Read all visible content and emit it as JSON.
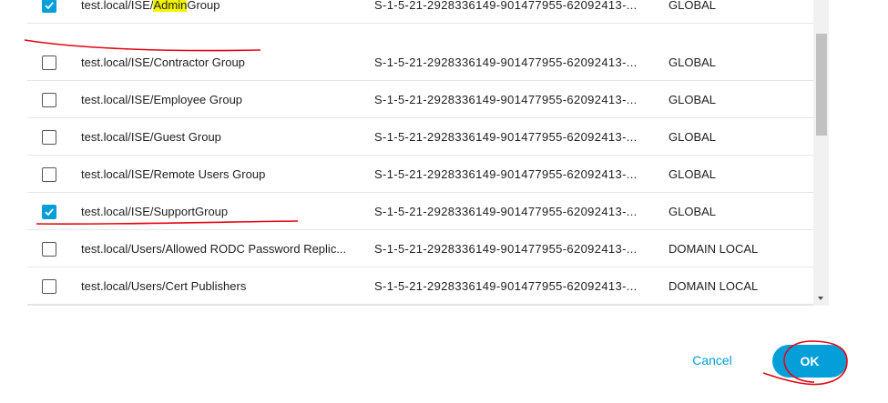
{
  "groups": [
    {
      "name_pre": "test.local/ISE/",
      "name_hl": "Admin",
      "name_post": "Group",
      "sid": "S-1-5-21-2928336149-901477955-62092413-...",
      "scope": "GLOBAL",
      "checked": true
    },
    {
      "name_pre": "test.local/ISE/Contractor Group",
      "name_hl": "",
      "name_post": "",
      "sid": "S-1-5-21-2928336149-901477955-62092413-...",
      "scope": "GLOBAL",
      "checked": false
    },
    {
      "name_pre": "test.local/ISE/Employee Group",
      "name_hl": "",
      "name_post": "",
      "sid": "S-1-5-21-2928336149-901477955-62092413-...",
      "scope": "GLOBAL",
      "checked": false
    },
    {
      "name_pre": "test.local/ISE/Guest Group",
      "name_hl": "",
      "name_post": "",
      "sid": "S-1-5-21-2928336149-901477955-62092413-...",
      "scope": "GLOBAL",
      "checked": false
    },
    {
      "name_pre": "test.local/ISE/Remote Users Group",
      "name_hl": "",
      "name_post": "",
      "sid": "S-1-5-21-2928336149-901477955-62092413-...",
      "scope": "GLOBAL",
      "checked": false
    },
    {
      "name_pre": "test.local/ISE/SupportGroup",
      "name_hl": "",
      "name_post": "",
      "sid": "S-1-5-21-2928336149-901477955-62092413-...",
      "scope": "GLOBAL",
      "checked": true
    },
    {
      "name_pre": "test.local/Users/Allowed RODC Password Replic...",
      "name_hl": "",
      "name_post": "",
      "sid": "S-1-5-21-2928336149-901477955-62092413-...",
      "scope": "DOMAIN LOCAL",
      "checked": false
    },
    {
      "name_pre": "test.local/Users/Cert Publishers",
      "name_hl": "",
      "name_post": "",
      "sid": "S-1-5-21-2928336149-901477955-62092413-...",
      "scope": "DOMAIN LOCAL",
      "checked": false
    }
  ],
  "actions": {
    "cancel_label": "Cancel",
    "ok_label": "OK"
  },
  "colors": {
    "accent": "#049fd9",
    "highlight": "#f4f400",
    "annotation": "#e30613"
  },
  "icons": {
    "checkbox_checked": "check-icon",
    "scroll_down": "scroll-down-arrow-icon"
  }
}
